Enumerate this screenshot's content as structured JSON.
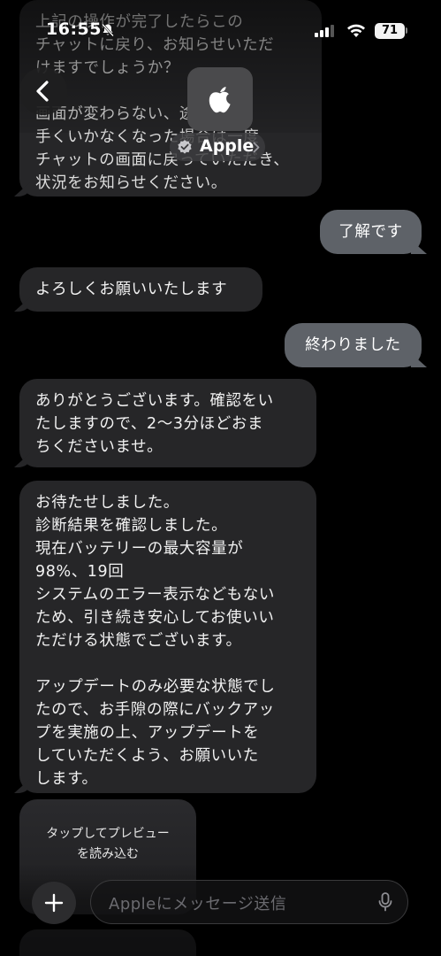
{
  "status_bar": {
    "time": "16:55",
    "battery": "71",
    "icons": [
      "bell-slash-icon",
      "signal-icon",
      "wifi-icon",
      "battery-icon"
    ]
  },
  "header": {
    "contact_name": "Apple",
    "icons": [
      "back-chevron-icon",
      "apple-logo-icon",
      "verified-badge-icon",
      "chevron-right-icon"
    ]
  },
  "messages": [
    {
      "direction": "in",
      "text": "上記の操作が完了したらこの\nチャットに戻り、お知らせいただ\nけますでしょうか？\n\n画面が変わらない、途中で上\n手くいかなくなった場合は一度\nチャットの画面に戻っていただき、\n状況をお知らせください。"
    },
    {
      "direction": "out",
      "text": "了解です"
    },
    {
      "direction": "in",
      "text": "よろしくお願いいたします"
    },
    {
      "direction": "out",
      "text": "終わりました"
    },
    {
      "direction": "in",
      "text": "ありがとうございます。確認をい\nたしますので、2〜3分ほどおま\nちくださいませ。"
    },
    {
      "direction": "in",
      "text": "お待たせしました。\n診断結果を確認しました。\n現在バッテリーの最大容量が\n98%、19回\nシステムのエラー表示などもない\nため、引き続き安心してお使いい\nただける状態でございます。\n\nアップデートのみ必要な状態でし\nたので、お手隙の際にバックアッ\nプを実施の上、アップデートを\nしていただくよう、お願いいた\nします。"
    }
  ],
  "preview": {
    "label": "タップしてプレビュー\nを読み込む"
  },
  "compose": {
    "placeholder": "Appleにメッセージ送信",
    "icons": [
      "plus-icon",
      "microphone-icon"
    ]
  },
  "colors": {
    "incoming_bubble": "#262628",
    "outgoing_bubble": "#5e6268",
    "background": "#000000"
  }
}
